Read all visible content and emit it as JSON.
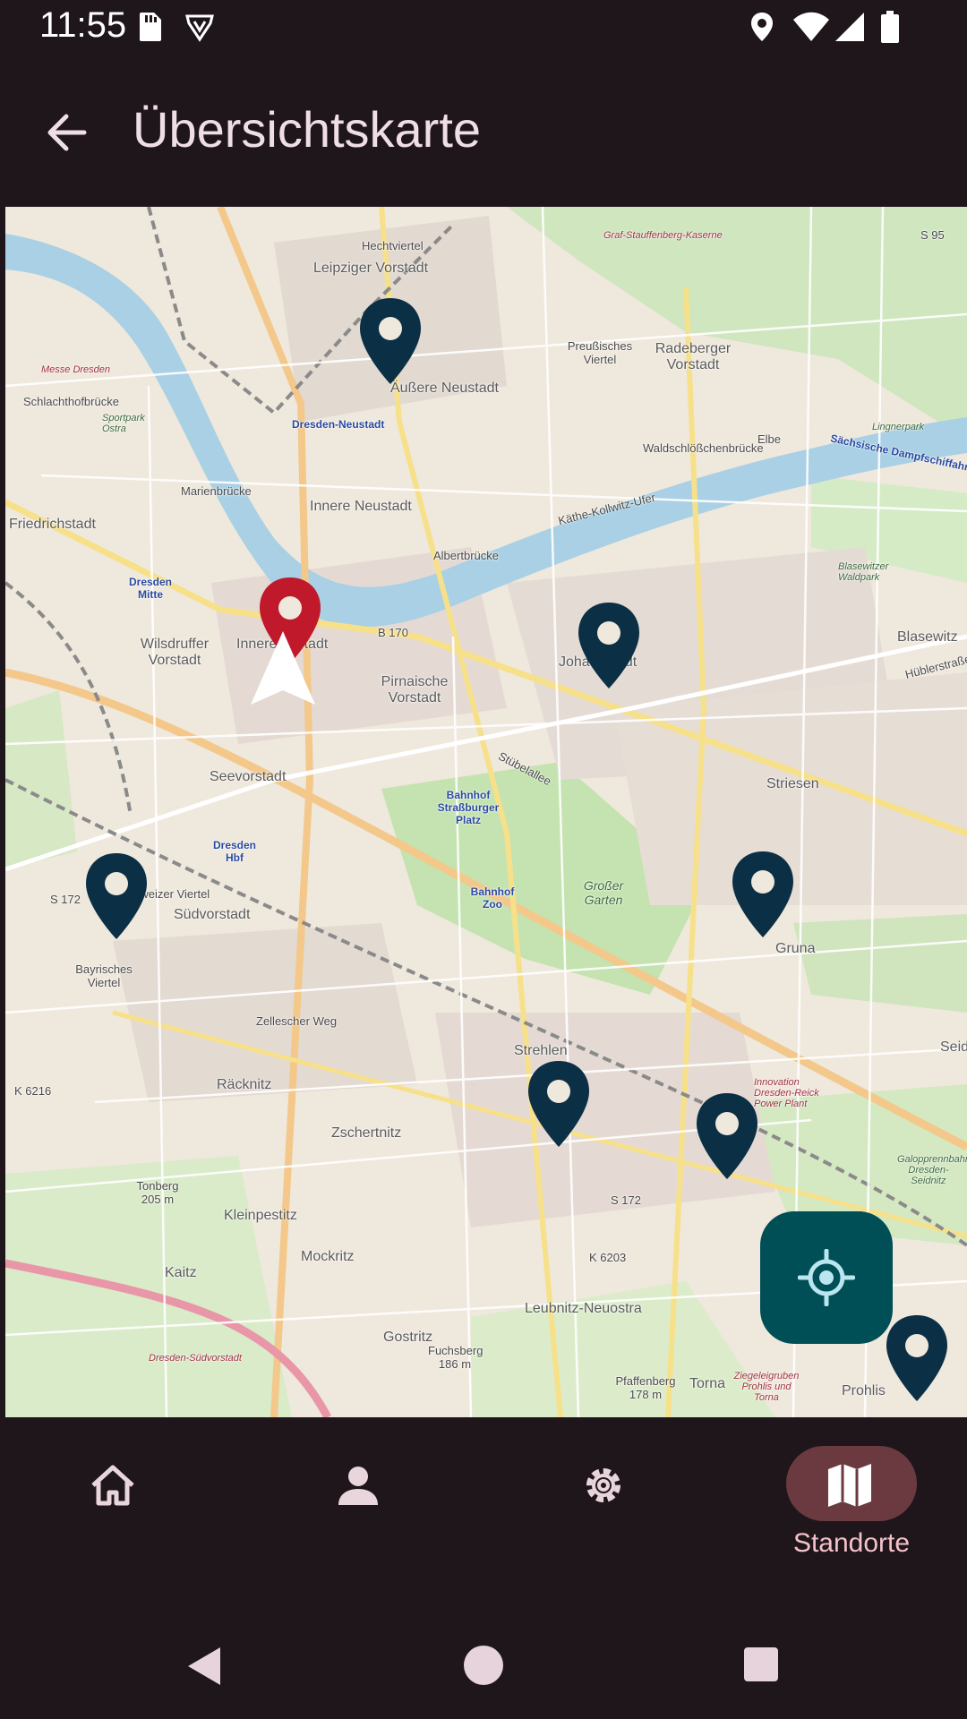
{
  "status_bar": {
    "time": "11:55",
    "icons": [
      "sd-card-icon",
      "shield-icon",
      "location-icon",
      "wifi-icon",
      "signal-icon",
      "battery-icon"
    ]
  },
  "app_bar": {
    "title": "Übersichtskarte",
    "back_icon": "arrow-back-icon"
  },
  "map": {
    "labels": [
      "Hechtviertel",
      "Leipziger Vorstadt",
      "Äußere Neustadt",
      "Preußisches Viertel",
      "Radeberger Vorstadt",
      "Graf-Stauffenberg-Kaserne",
      "S 95",
      "Messe Dresden",
      "Schlachthofbrücke",
      "Sportpark Ostra",
      "Dresden-Neustadt",
      "Marienbrücke",
      "Innere Neustadt",
      "Waldschlößchenbrücke",
      "Elbe",
      "Sächsische Dampfschiffahrt",
      "Friedrichstadt",
      "Albertbrücke",
      "Käthe-Kollwitz-Ufer",
      "Blasewitzer Waldpark",
      "Dresden Mitte",
      "Wilsdruffer Vorstadt",
      "Innere Altstadt",
      "B 170",
      "Pirnaische Vorstadt",
      "Johannstadt",
      "Blasewitz",
      "Hüblerstraße",
      "Seevorstadt",
      "Bahnhof Straßburger Platz",
      "Striesen",
      "Dresden Hbf",
      "Bahnhof Zoo",
      "Großer Garten",
      "S 172",
      "Schweizer Viertel",
      "Südvorstadt",
      "Gruna",
      "Bayrisches Viertel",
      "Zellescher Weg",
      "Strehlen",
      "K 6216",
      "Räcknitz",
      "Zschertnitz",
      "Innovation Dresden-Reick Power Plant",
      "Galopprennbahn Dresden-Seidnitz",
      "Tonberg 205 m",
      "Kleinpestitz",
      "S 172",
      "Mockritz",
      "K 6203",
      "Kaitz",
      "Leubnitz-Neuostra",
      "Gostritz",
      "Fuchsberg 186 m",
      "Pfaffenberg 178 m",
      "Torna",
      "Ziegeleigruben Prohlis und Torna",
      "Prohlis",
      "Dresden-Südvorstadt",
      "Stübelallee",
      "Lingnerpark",
      "Seid",
      "Kaserne"
    ],
    "markers": [
      "location-pin",
      "location-pin",
      "location-pin",
      "location-pin",
      "location-pin",
      "location-pin",
      "location-pin"
    ],
    "selected_marker": "location-pin-selected",
    "user_position_icon": "navigation-arrow-icon"
  },
  "fab": {
    "icon": "my-location-icon"
  },
  "bottom_nav": {
    "items": [
      {
        "icon": "home-icon",
        "label": ""
      },
      {
        "icon": "person-icon",
        "label": ""
      },
      {
        "icon": "settings-icon",
        "label": ""
      },
      {
        "icon": "map-icon",
        "label": "Standorte"
      }
    ],
    "active_index": 3
  },
  "system_nav": {
    "icons": [
      "back-triangle-icon",
      "home-circle-icon",
      "recents-square-icon"
    ]
  },
  "colors": {
    "background": "#1f161b",
    "accent_pill": "#6b3a40",
    "fab": "#004f57",
    "marker": "#0b2f45",
    "marker_selected": "#c0192c",
    "label": "#f4c2c8"
  }
}
